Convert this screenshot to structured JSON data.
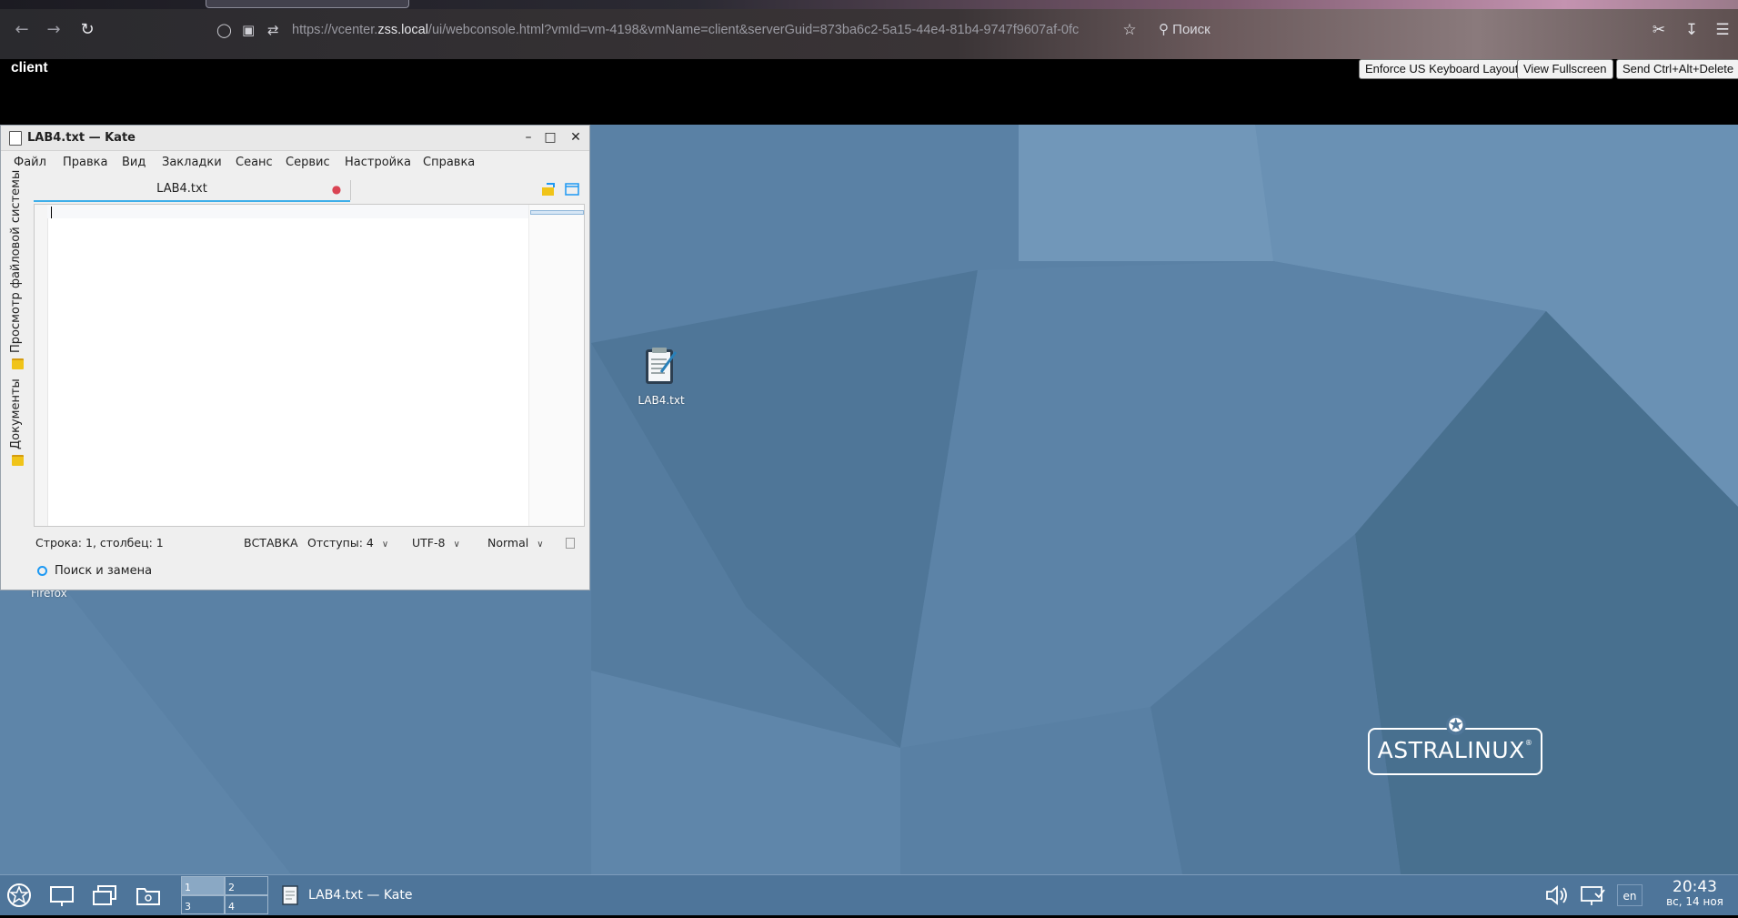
{
  "browser": {
    "url_prefix": "https://vcenter.",
    "url_host": "zss.local",
    "url_rest": "/ui/webconsole.html?vmId=vm-4198&vmName=client&serverGuid=873ba6c2-5a15-44e4-81b4-9747f9607af-0fc",
    "search_label": "Поиск"
  },
  "console": {
    "vm_name": "client",
    "buttons": {
      "enforce_keyboard": "Enforce US Keyboard Layout",
      "fullscreen": "View Fullscreen",
      "send_cad": "Send Ctrl+Alt+Delete"
    }
  },
  "kate": {
    "title": "LAB4.txt  — Kate",
    "menu": [
      "Файл",
      "Правка",
      "Вид",
      "Закладки",
      "Сеанс",
      "Сервис",
      "Настройка",
      "Справка"
    ],
    "side_tabs": {
      "filesystem": "Просмотр файловой системы",
      "documents": "Документы"
    },
    "tab_label": "LAB4.txt",
    "status": {
      "position": "Строка: 1, столбец: 1",
      "mode": "ВСТАВКА",
      "indent": "Отступы: 4",
      "encoding": "UTF-8",
      "syntax": "Normal"
    },
    "search_replace": "Поиск и замена"
  },
  "desktop": {
    "icons": [
      {
        "label": "LAB4.txt"
      }
    ],
    "firefox_label": "Firefox",
    "logo_text": "ASTRALINUX"
  },
  "taskbar": {
    "pager": [
      "1",
      "2",
      "3",
      "4"
    ],
    "task_label": "LAB4.txt  — Kate",
    "lang": "en",
    "time": "20:43",
    "date": "вс, 14 ноя"
  }
}
